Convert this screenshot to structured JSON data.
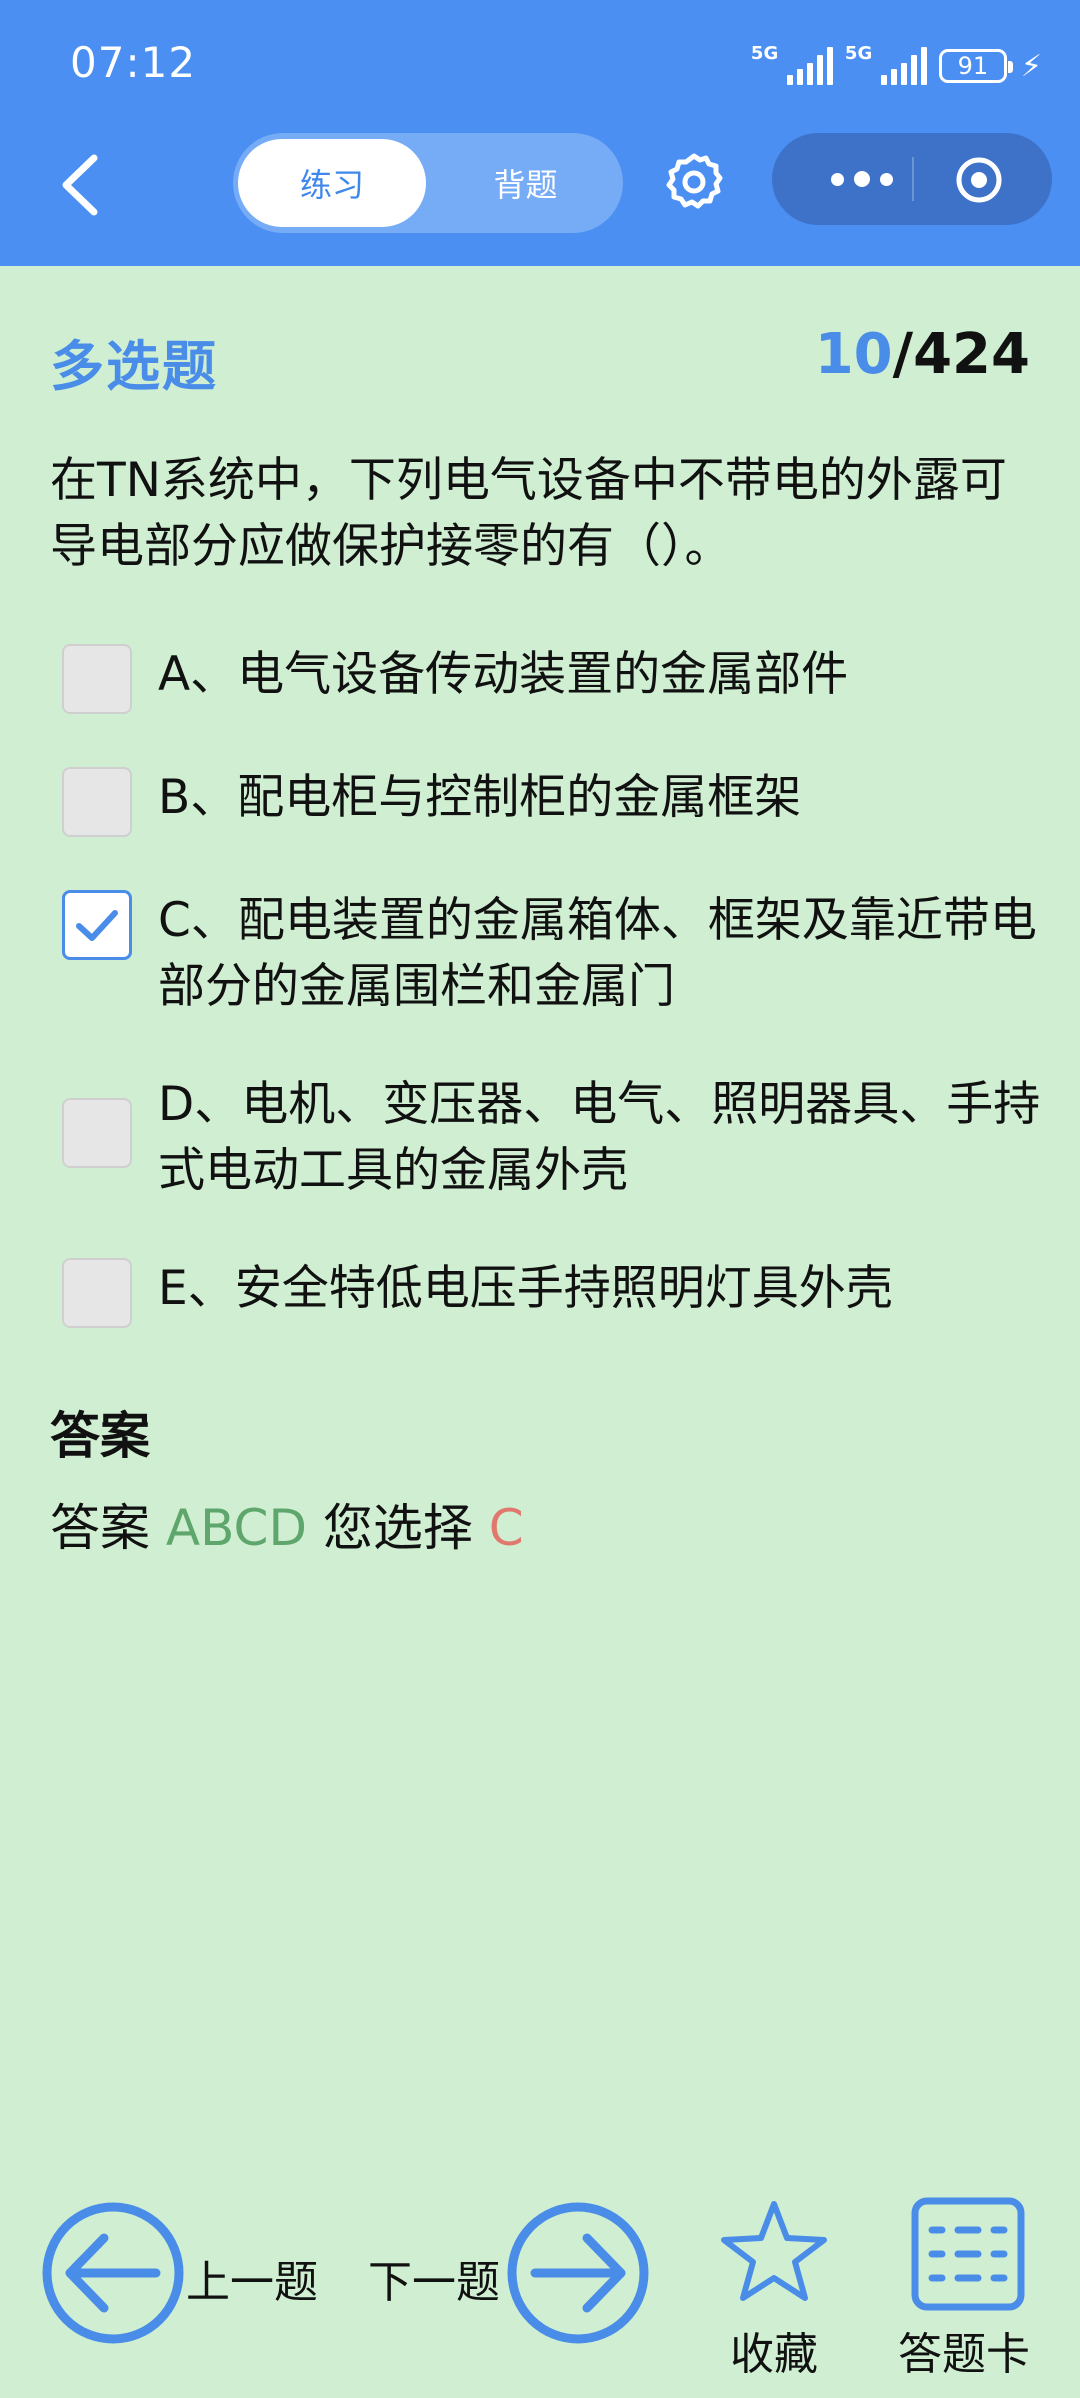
{
  "status": {
    "time": "07:12",
    "signal1": "5G",
    "signal2": "5G",
    "battery": "91"
  },
  "header": {
    "tabs": [
      {
        "label": "练习",
        "active": true
      },
      {
        "label": "背题",
        "active": false
      }
    ]
  },
  "question": {
    "type": "多选题",
    "current": "10",
    "separator": "/",
    "total": "424",
    "text": "在TN系统中，下列电气设备中不带电的外露可导电部分应做保护接零的有（）。",
    "options": [
      {
        "label": "A、电气设备传动装置的金属部件",
        "checked": false
      },
      {
        "label": "B、配电柜与控制柜的金属框架",
        "checked": false
      },
      {
        "label": "C、配电装置的金属箱体、框架及靠近带电部分的金属围栏和金属门",
        "checked": true
      },
      {
        "label": "D、电机、变压器、电气、照明器具、手持式电动工具的金属外壳",
        "checked": false
      },
      {
        "label": "E、安全特低电压手持照明灯具外壳",
        "checked": false
      }
    ]
  },
  "answer": {
    "heading": "答案",
    "prefix": "答案",
    "correct": "ABCD",
    "chosen_prefix": "您选择",
    "chosen": "C"
  },
  "bottom": {
    "prev_label": "上一题",
    "next_label": "下一题",
    "favorite_label": "收藏",
    "card_label": "答题卡"
  },
  "colors": {
    "header": "#4b8ff2",
    "background": "#d0efd2",
    "accent": "#4a8de8",
    "correct": "#5fa66c",
    "chosen": "#e0786d"
  }
}
